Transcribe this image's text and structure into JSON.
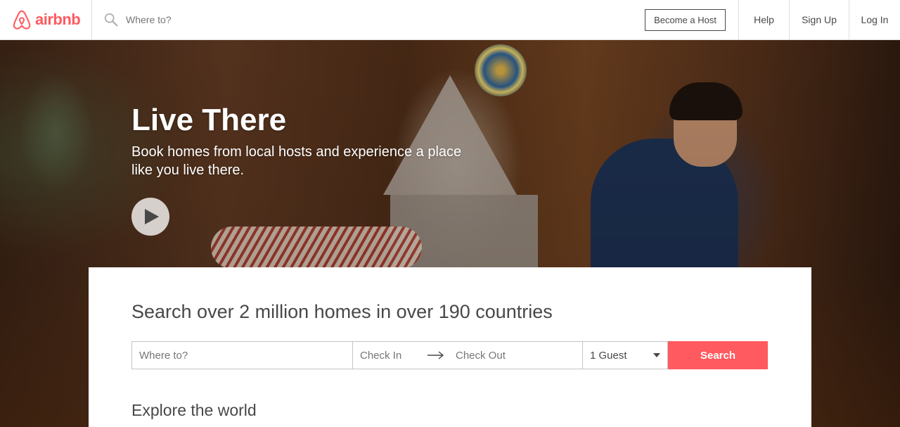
{
  "header": {
    "logo_text": "airbnb",
    "search_placeholder": "Where to?",
    "nav": {
      "become_host": "Become a Host",
      "help": "Help",
      "sign_up": "Sign Up",
      "log_in": "Log In"
    }
  },
  "hero": {
    "title": "Live There",
    "subtitle": "Book homes from local hosts and experience a place like you live there."
  },
  "search_panel": {
    "title": "Search over 2 million homes in over 190 countries",
    "where_placeholder": "Where to?",
    "check_in": "Check In",
    "check_out": "Check Out",
    "guests": "1 Guest",
    "search_button": "Search",
    "explore_heading": "Explore the world"
  },
  "colors": {
    "brand": "#ff5a5f",
    "text": "#484848",
    "muted": "#767676"
  },
  "icons": {
    "logo": "airbnb-belo-icon",
    "search": "search-icon",
    "play": "play-icon",
    "arrow": "arrow-right-icon",
    "caret": "caret-down-icon"
  }
}
